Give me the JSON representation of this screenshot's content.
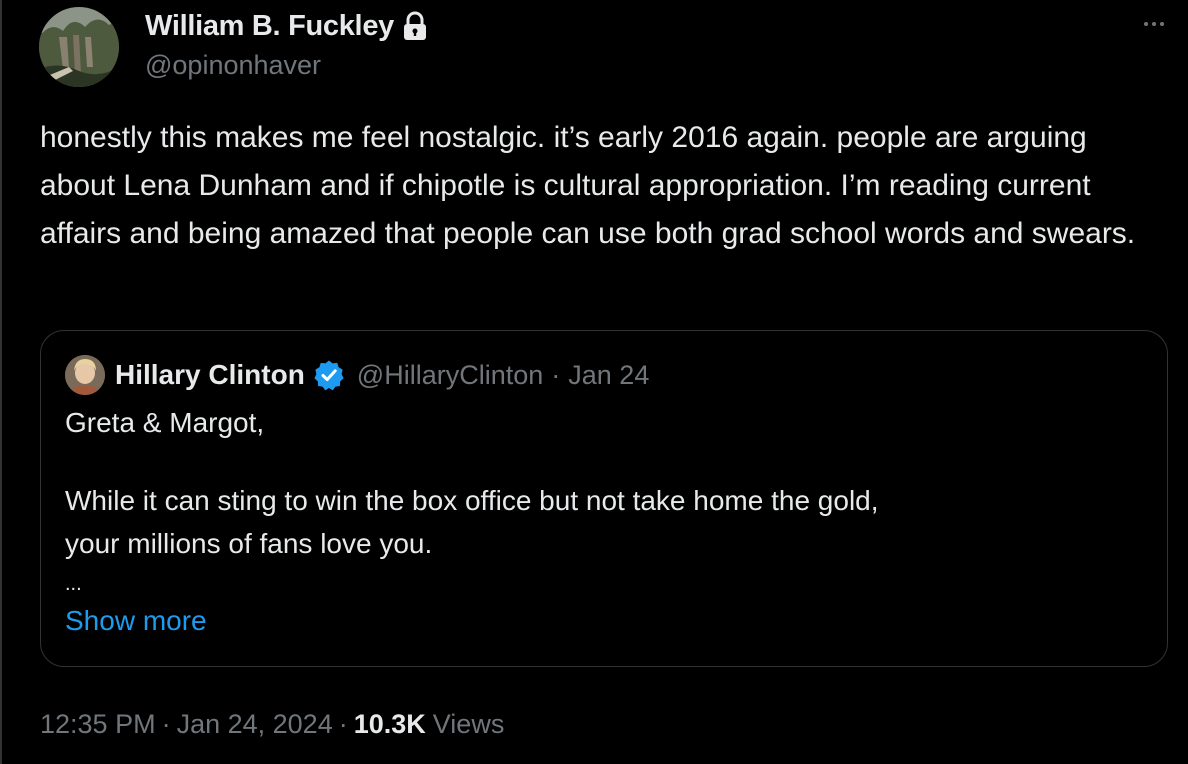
{
  "author": {
    "display_name": "William B. Fuckley",
    "handle": "@opinonhaver",
    "protected_icon": "lock-icon"
  },
  "menu_icon": "more-horizontal-icon",
  "tweet": {
    "text": "honestly this makes me feel nostalgic.  it’s early 2016 again. people are arguing about Lena Dunham and if chipotle is cultural appropriation. I’m reading current affairs and being amazed that people can use both grad school words and swears."
  },
  "quoted_tweet": {
    "display_name": "Hillary Clinton",
    "verified_icon": "verified-badge-icon",
    "handle": "@HillaryClinton",
    "separator": "·",
    "date": "Jan 24",
    "lines": [
      "Greta & Margot,",
      "While it can sting to win the box office but not take home the gold,",
      "your millions of fans love you.",
      "..."
    ],
    "show_more_label": "Show more"
  },
  "meta": {
    "time": "12:35 PM",
    "separator": "·",
    "date": "Jan 24, 2024",
    "views_count": "10.3K",
    "views_label": "Views"
  },
  "colors": {
    "background": "#000000",
    "text_primary": "#e7e9ea",
    "text_secondary": "#71767b",
    "border": "#2f3336",
    "link": "#1d9bf0",
    "verified": "#1d9bf0"
  }
}
